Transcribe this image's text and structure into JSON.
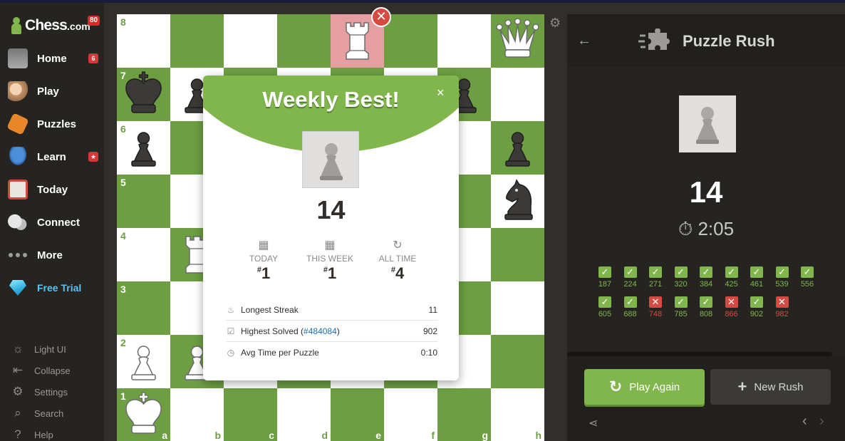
{
  "brand": {
    "name": "Chess",
    "tld": ".com",
    "badge": "80"
  },
  "nav": [
    {
      "label": "Home",
      "badge": "6"
    },
    {
      "label": "Play"
    },
    {
      "label": "Puzzles"
    },
    {
      "label": "Learn",
      "badge": "★"
    },
    {
      "label": "Today"
    },
    {
      "label": "Connect"
    },
    {
      "label": "More"
    },
    {
      "label": "Free Trial"
    }
  ],
  "bottom_nav": [
    {
      "label": "Light UI",
      "icon": "sun-icon"
    },
    {
      "label": "Collapse",
      "icon": "collapse-icon"
    },
    {
      "label": "Settings",
      "icon": "gear-icon"
    },
    {
      "label": "Search",
      "icon": "search-icon"
    },
    {
      "label": "Help",
      "icon": "help-icon"
    }
  ],
  "board": {
    "ranks": [
      "8",
      "7",
      "6",
      "5",
      "4",
      "3",
      "2",
      "1"
    ],
    "files": [
      "a",
      "b",
      "c",
      "d",
      "e",
      "f",
      "g",
      "h"
    ],
    "highlighted_square": "e8",
    "pieces": [
      {
        "square": "e8",
        "piece": "wR"
      },
      {
        "square": "h8",
        "piece": "wQ"
      },
      {
        "square": "a7",
        "piece": "bK"
      },
      {
        "square": "b7",
        "piece": "bP"
      },
      {
        "square": "g7",
        "piece": "bP"
      },
      {
        "square": "a6",
        "piece": "bP"
      },
      {
        "square": "h6",
        "piece": "bP"
      },
      {
        "square": "h5",
        "piece": "bN"
      },
      {
        "square": "b4",
        "piece": "wR"
      },
      {
        "square": "a2",
        "piece": "wP"
      },
      {
        "square": "b2",
        "piece": "wP"
      },
      {
        "square": "a1",
        "piece": "wK"
      }
    ]
  },
  "modal": {
    "title": "Weekly Best!",
    "close": "×",
    "score": "14",
    "stats": [
      {
        "label": "TODAY",
        "rank": "1",
        "icon": "calendar-icon"
      },
      {
        "label": "THIS WEEK",
        "rank": "1",
        "icon": "calendar-icon"
      },
      {
        "label": "ALL TIME",
        "rank": "4",
        "icon": "refresh-icon"
      }
    ],
    "rows": {
      "streak": {
        "label": "Longest Streak",
        "value": "11"
      },
      "solved": {
        "label_pre": "Highest Solved (",
        "link": "#484084",
        "label_post": ")",
        "value": "902"
      },
      "avg": {
        "label": "Avg Time per Puzzle",
        "value": "0:10"
      }
    }
  },
  "panel": {
    "title": "Puzzle Rush",
    "score": "14",
    "timer": "2:05",
    "results": [
      {
        "n": "187",
        "ok": true
      },
      {
        "n": "224",
        "ok": true
      },
      {
        "n": "271",
        "ok": true
      },
      {
        "n": "320",
        "ok": true
      },
      {
        "n": "384",
        "ok": true
      },
      {
        "n": "425",
        "ok": true
      },
      {
        "n": "461",
        "ok": true
      },
      {
        "n": "539",
        "ok": true
      },
      {
        "n": "556",
        "ok": true
      },
      {
        "n": "605",
        "ok": true
      },
      {
        "n": "688",
        "ok": true
      },
      {
        "n": "748",
        "ok": false
      },
      {
        "n": "785",
        "ok": true
      },
      {
        "n": "808",
        "ok": true
      },
      {
        "n": "866",
        "ok": false
      },
      {
        "n": "902",
        "ok": true
      },
      {
        "n": "982",
        "ok": false
      }
    ],
    "play_again": "Play Again",
    "new_rush": "New Rush"
  },
  "colors": {
    "accent": "#81b64c",
    "error": "#d64a44",
    "board_dark": "#6d9f42",
    "board_light": "#ffffff"
  }
}
